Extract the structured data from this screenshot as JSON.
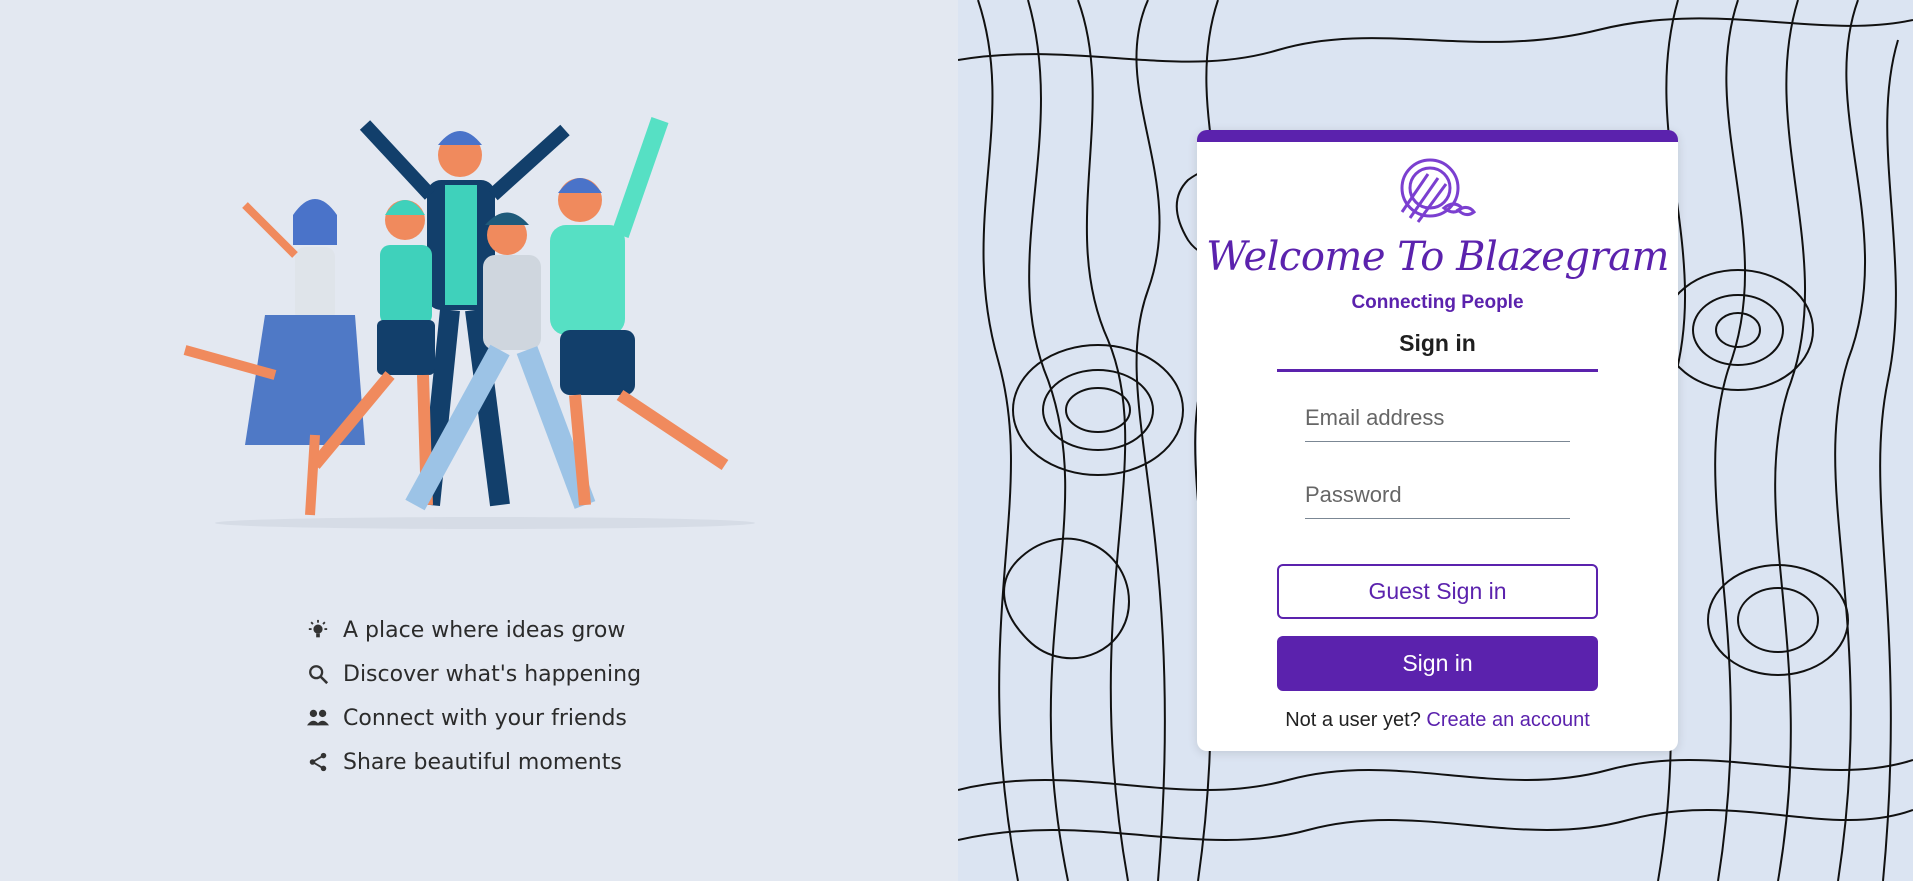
{
  "features": [
    {
      "icon": "lightbulb-icon",
      "text": "A place where ideas grow"
    },
    {
      "icon": "search-icon",
      "text": "Discover what's happening"
    },
    {
      "icon": "people-icon",
      "text": "Connect with your friends"
    },
    {
      "icon": "share-icon",
      "text": "Share beautiful moments"
    }
  ],
  "card": {
    "logo_icon": "blazegram-bird-logo-icon",
    "title": "Welcome To Blazegram",
    "tagline": "Connecting People",
    "tab_label": "Sign in",
    "email_placeholder": "Email address",
    "password_placeholder": "Password",
    "guest_button": "Guest Sign in",
    "signin_button": "Sign in",
    "footer_text": "Not a user yet?",
    "footer_link": "Create an account"
  },
  "colors": {
    "brand": "#5b22ad",
    "left_bg": "#e3e8f1",
    "right_bg": "#dbe4f2"
  }
}
